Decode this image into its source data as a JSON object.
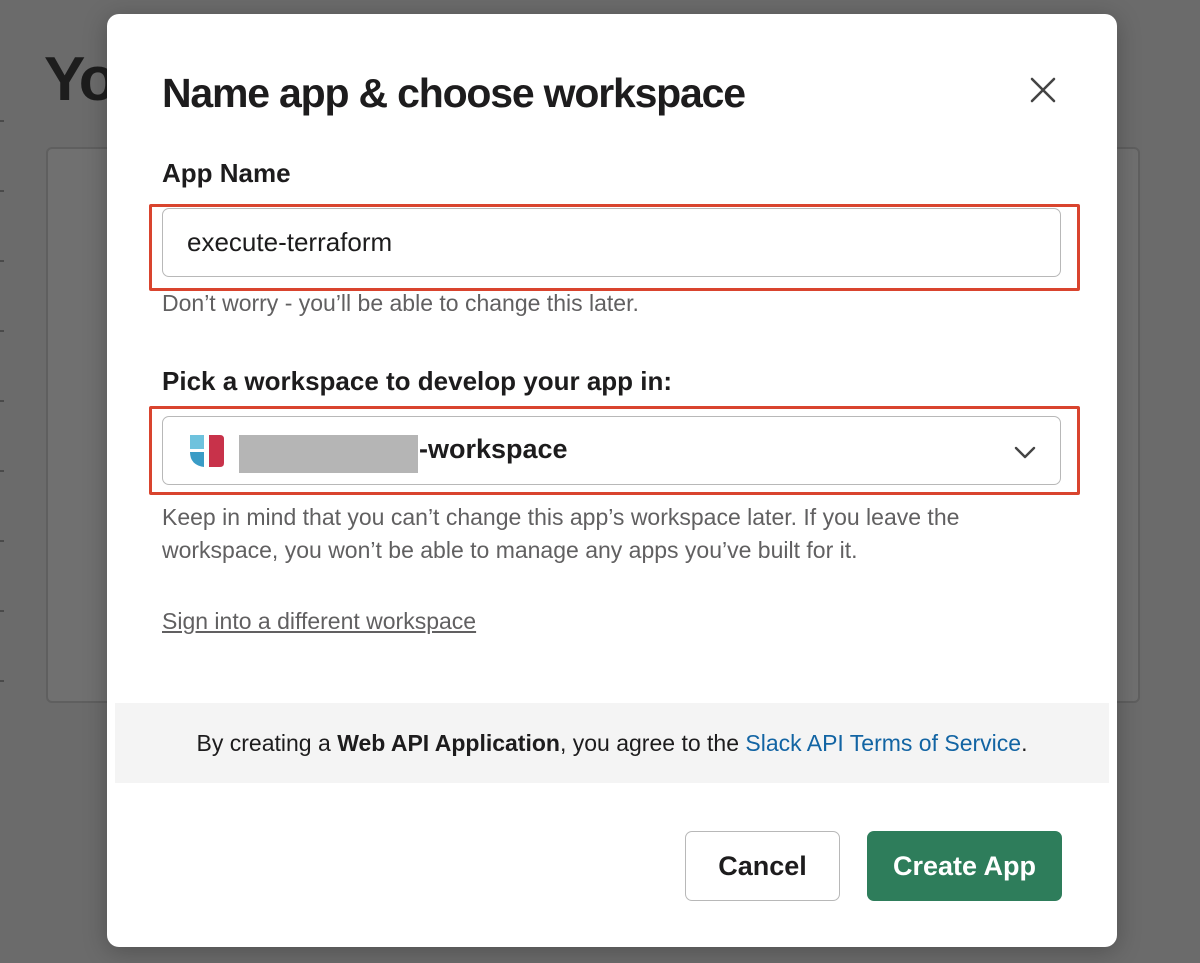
{
  "background": {
    "heading": "Yo"
  },
  "modal": {
    "title": "Name app & choose workspace",
    "app_name": {
      "label": "App Name",
      "value": "execute-terraform",
      "hint": "Don’t worry - you’ll be able to change this later."
    },
    "workspace": {
      "label": "Pick a workspace to develop your app in:",
      "selected_suffix": "-workspace",
      "hint": "Keep in mind that you can’t change this app’s workspace later. If you leave the workspace, you won’t be able to manage any apps you’ve built for it."
    },
    "sign_in_link": "Sign into a different workspace",
    "terms": {
      "prefix": "By creating a ",
      "bold": "Web API Application",
      "middle": ", you agree to the ",
      "link": "Slack API Terms of Service",
      "suffix": "."
    },
    "buttons": {
      "cancel": "Cancel",
      "create": "Create App"
    }
  },
  "colors": {
    "primary_button": "#2e7d5b",
    "link": "#1264a3",
    "highlight": "#d9442e"
  }
}
